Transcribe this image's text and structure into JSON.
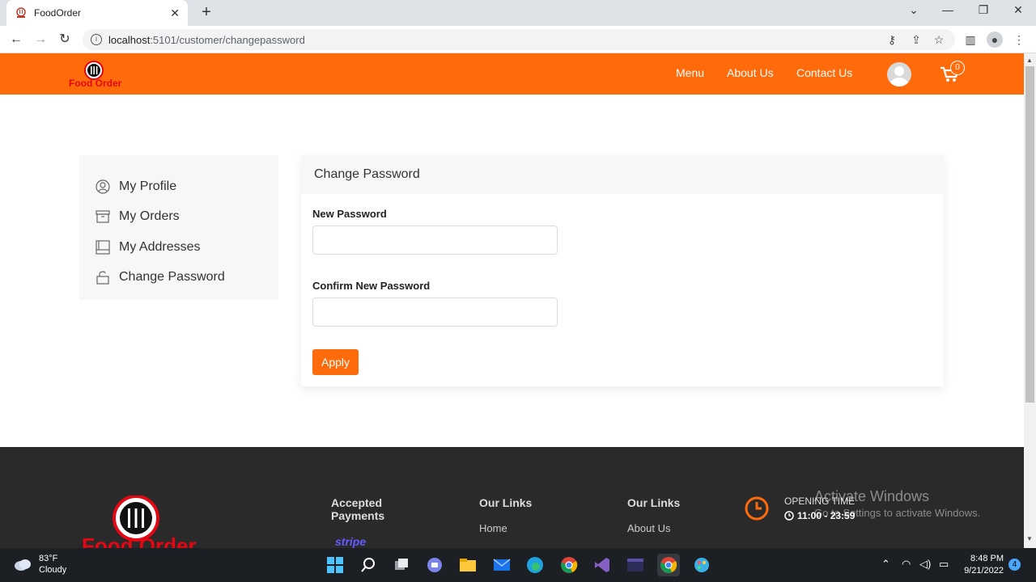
{
  "browser": {
    "tab_title": "FoodOrder",
    "tab_close": "✕",
    "new_tab": "+",
    "url_host": "localhost",
    "url_rest": ":5101/customer/changepassword"
  },
  "header": {
    "logo_text": "Food Order",
    "nav": [
      "Menu",
      "About Us",
      "Contact Us"
    ],
    "cart_count": "0"
  },
  "sidebar": {
    "items": [
      {
        "label": "My Profile",
        "icon": "user-circle-icon"
      },
      {
        "label": "My Orders",
        "icon": "archive-box-icon"
      },
      {
        "label": "My Addresses",
        "icon": "address-book-icon"
      },
      {
        "label": "Change Password",
        "icon": "unlock-icon"
      }
    ]
  },
  "form": {
    "title": "Change Password",
    "new_password_label": "New Password",
    "new_password_value": "",
    "confirm_password_label": "Confirm New Password",
    "confirm_password_value": "",
    "apply_label": "Apply"
  },
  "footer": {
    "logo_text": "Food Order",
    "payments_heading": "Accepted Payments",
    "payment_brand": "stripe",
    "links_heading_1": "Our Links",
    "link_1": "Home",
    "links_heading_2": "Our Links",
    "link_2": "About Us",
    "opening_label": "OPENING TIME",
    "opening_hours": "11:00 - 23:59"
  },
  "watermark": {
    "line1": "Activate Windows",
    "line2": "Go to Settings to activate Windows."
  },
  "taskbar": {
    "temp": "83°F",
    "condition": "Cloudy",
    "time": "8:48 PM",
    "date": "9/21/2022",
    "notifications": "4"
  },
  "colors": {
    "brand_orange": "#ff6b0a",
    "footer_bg": "#2a2a2a",
    "logo_red": "#e30613"
  }
}
